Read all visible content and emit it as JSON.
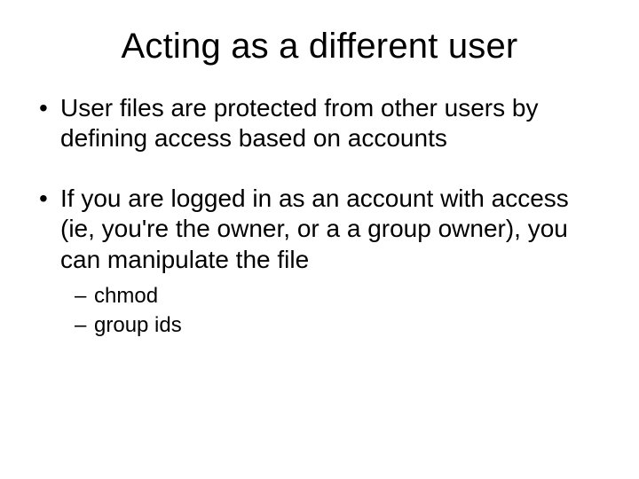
{
  "title": "Acting as a different user",
  "bullets": [
    {
      "text": "User files are protected from other users by defining access based on accounts",
      "sub": []
    },
    {
      "text": "If you are logged in as an account with access (ie, you're the owner, or a a group owner), you can manipulate the file",
      "sub": [
        {
          "text": "chmod"
        },
        {
          "text": "group ids"
        }
      ]
    }
  ]
}
